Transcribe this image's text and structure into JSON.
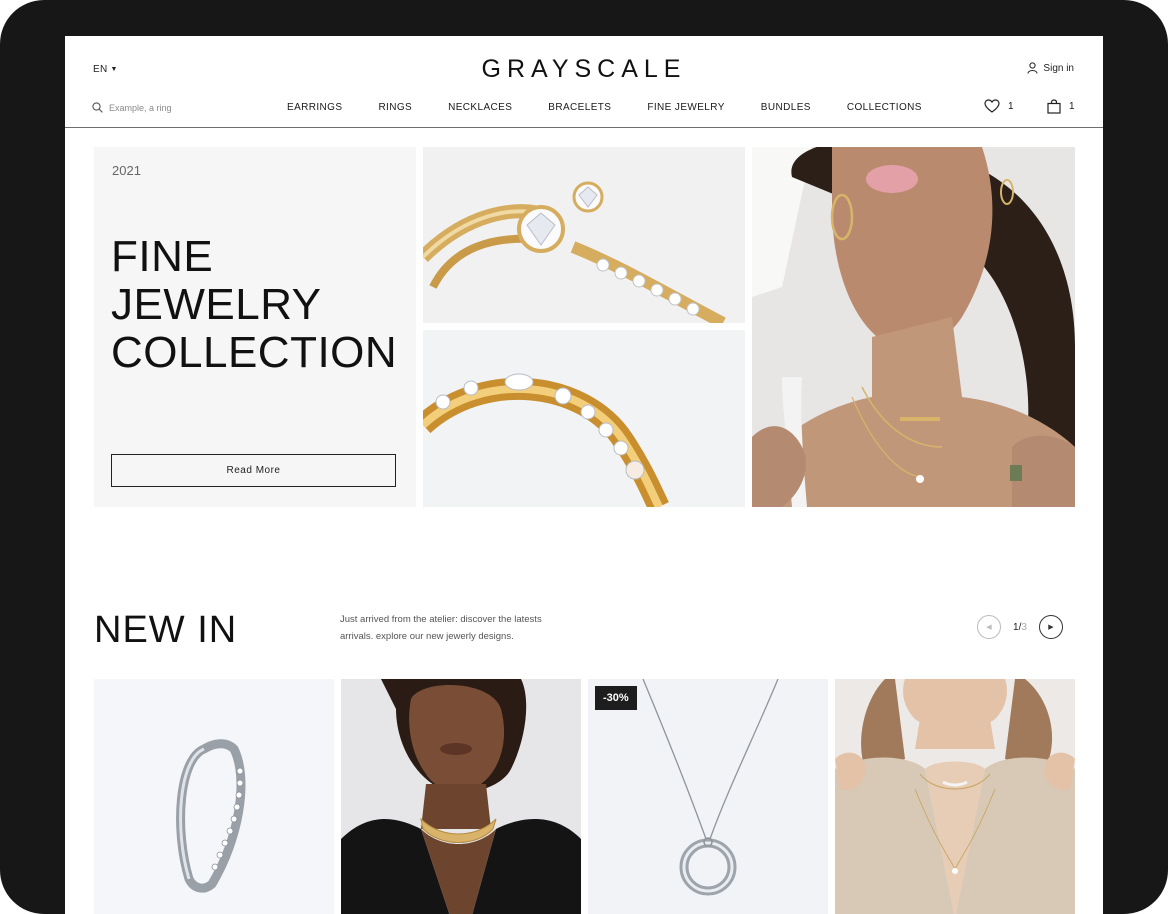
{
  "header": {
    "language": "EN",
    "logo": "GRAYSCALE",
    "sign_in": "Sign in",
    "search_placeholder": "Example, a ring",
    "nav": [
      "EARRINGS",
      "RINGS",
      "NECKLACES",
      "BRACELETS",
      "FINE JEWELRY",
      "BUNDLES",
      "COLLECTIONS"
    ],
    "wishlist_count": "1",
    "cart_count": "1"
  },
  "hero": {
    "year": "2021",
    "title_lines": [
      "FINE",
      "JEWELRY",
      "COLLECTION"
    ],
    "button": "Read More"
  },
  "new_in": {
    "title": "NEW IN",
    "description": "Just arrived from the atelier: discover the latests arrivals. explore our new jewerly designs.",
    "page_current": "1",
    "page_total": "3",
    "products": [
      {
        "icon": "hoop-earring-image"
      },
      {
        "icon": "model-gold-choker-image"
      },
      {
        "icon": "pendant-necklace-image",
        "badge": "-30%"
      },
      {
        "icon": "model-necklace-image"
      }
    ]
  },
  "colors": {
    "frame": "#171717",
    "panel": "#f6f6f6",
    "text": "#111111",
    "gold": "#d9b36a",
    "badge": "#1d1d1d"
  }
}
